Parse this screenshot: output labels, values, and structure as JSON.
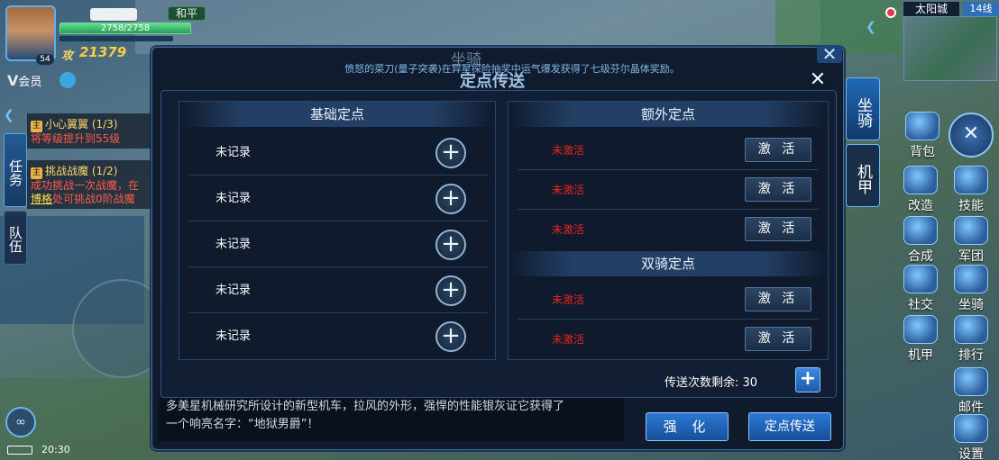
{
  "hud": {
    "level": "54",
    "faction_mode": "和平",
    "hp_text": "2758/2758",
    "hp_fraction": 1.0,
    "power_icon": "攻",
    "power": "21379",
    "vip_label": "会员"
  },
  "tabs": {
    "task": "任务",
    "team": "队伍"
  },
  "quests": [
    {
      "title": "小心翼翼 (1/3)",
      "desc": "将等级提升到55级"
    },
    {
      "title": "挑战战魔 (1/2)",
      "desc_a": "成功挑战一次战魔，在",
      "desc_link": "博格",
      "desc_b": "处可挑战0阶战魔"
    }
  ],
  "status": {
    "time": "20:30"
  },
  "minimap": {
    "map_name": "太阳城",
    "line": "14线"
  },
  "right_menu": [
    "背包",
    "改造",
    "技能",
    "合成",
    "军团",
    "社交",
    "坐骑",
    "机甲",
    "排行",
    "邮件",
    "设置"
  ],
  "modal": {
    "title_back": "坐骑",
    "title": "定点传送",
    "notice": "愤怒的菜刀(量子突袭)在异星探险抽奖中运气爆发获得了七级芬尔晶体奖励。",
    "left_header": "基础定点",
    "left_rows": [
      "未记录",
      "未记录",
      "未记录",
      "未记录",
      "未记录"
    ],
    "extra_header": "额外定点",
    "extra_rows": [
      {
        "status": "未激活",
        "button": "激 活"
      },
      {
        "status": "未激活",
        "button": "激 活"
      },
      {
        "status": "未激活",
        "button": "激 活"
      }
    ],
    "dual_header": "双骑定点",
    "dual_rows": [
      {
        "status": "未激活",
        "button": "激 活"
      },
      {
        "status": "未激活",
        "button": "激 活"
      }
    ],
    "count_label": "传送次数剩余: 30",
    "side_tab_mount": "坐骑",
    "side_tab_mech": "机甲",
    "strengthen": "强 化",
    "teleport": "定点传送"
  },
  "chat": {
    "line1": "多美星机械研究所设计的新型机车，拉风的外形，强悍的性能银灰证它获得了",
    "line2": "一个响亮名字：“地狱男爵”！"
  }
}
